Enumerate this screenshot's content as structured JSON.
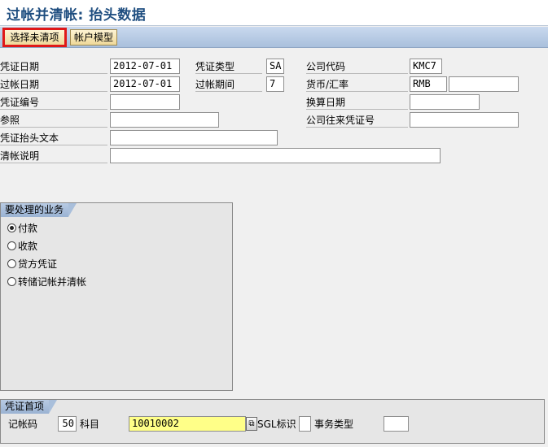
{
  "title": "过帐并清帐: 抬头数据",
  "toolbar": {
    "select_open_items": "选择未清项",
    "account_model": "帐户模型"
  },
  "header": {
    "doc_date_label": "凭证日期",
    "doc_date_value": "2012-07-01",
    "doc_type_label": "凭证类型",
    "doc_type_value": "SA",
    "company_code_label": "公司代码",
    "company_code_value": "KMC7",
    "posting_date_label": "过帐日期",
    "posting_date_value": "2012-07-01",
    "period_label": "过帐期间",
    "period_value": "7",
    "currency_label": "货币/汇率",
    "currency_value": "RMB",
    "rate_value": "",
    "doc_number_label": "凭证编号",
    "doc_number_value": "",
    "translation_date_label": "换算日期",
    "translation_date_value": "",
    "reference_label": "参照",
    "reference_value": "",
    "intercompany_label": "公司往来凭证号",
    "intercompany_value": "",
    "header_text_label": "凭证抬头文本",
    "header_text_value": "",
    "clearing_text_label": "清帐说明",
    "clearing_text_value": ""
  },
  "business": {
    "title": "要处理的业务",
    "options": [
      {
        "label": "付款",
        "selected": true
      },
      {
        "label": "收款",
        "selected": false
      },
      {
        "label": "贷方凭证",
        "selected": false
      },
      {
        "label": "转储记帐并清帐",
        "selected": false
      }
    ]
  },
  "first_item": {
    "title": "凭证首项",
    "posting_key_label": "记帐码",
    "posting_key_value": "50",
    "account_label": "科目",
    "account_value": "10010002",
    "sgl_label": "SGL标识",
    "sgl_value": "",
    "trans_type_label": "事务类型",
    "trans_type_value": ""
  }
}
